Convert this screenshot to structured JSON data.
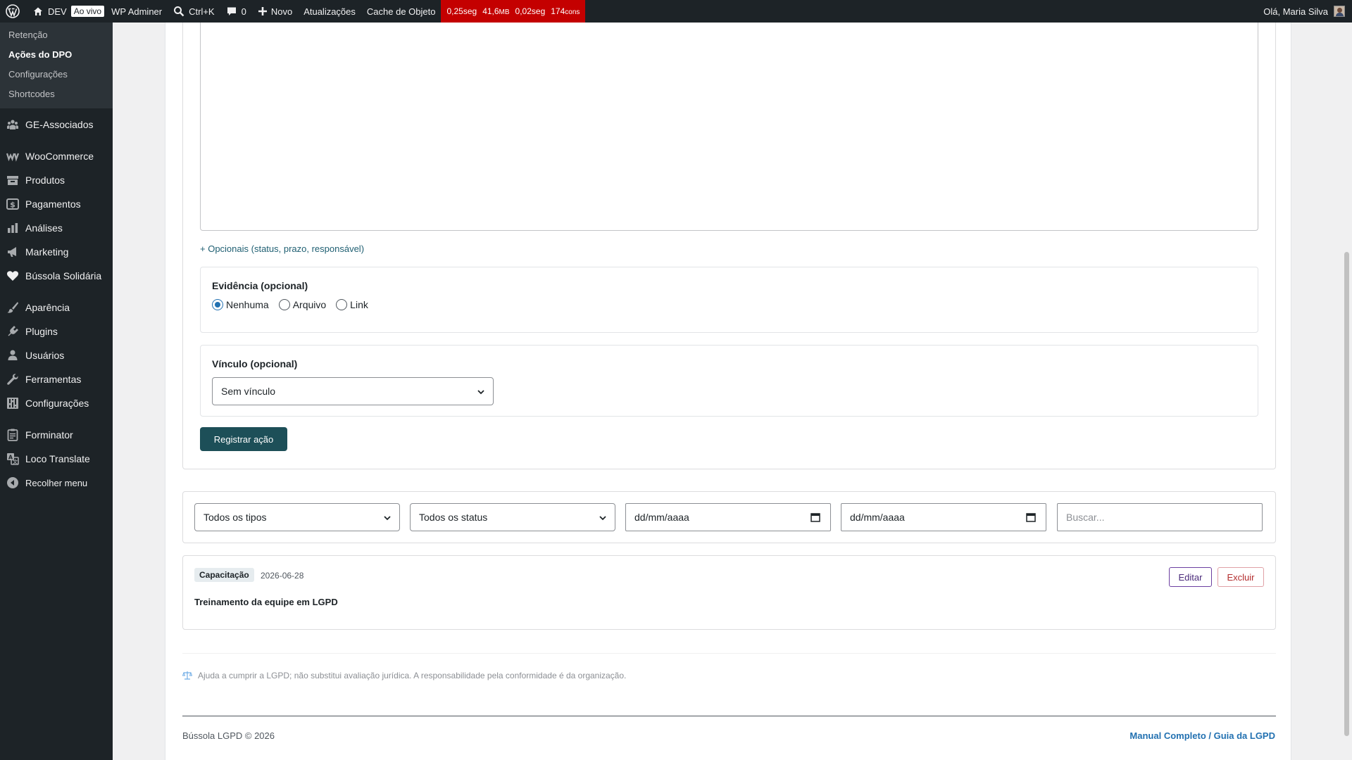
{
  "admin_bar": {
    "site_name": "DEV",
    "live_badge": "Ao vivo",
    "wp_adminer": "WP Adminer",
    "search_shortcut": "Ctrl+K",
    "comments_count": "0",
    "new_label": "Novo",
    "updates_label": "Atualizações",
    "object_cache_label": "Cache de Objeto",
    "perf": {
      "time": "0,25seg",
      "memory_value": "41,6",
      "memory_unit": "MB",
      "query_time": "0,02seg",
      "queries_value": "174",
      "queries_unit": "cons"
    },
    "greeting": "Olá, Maria Silva",
    "perf_color": "#c40000"
  },
  "sidebar": {
    "submenu": [
      {
        "label": "Retenção",
        "current": false
      },
      {
        "label": "Ações do DPO",
        "current": true
      },
      {
        "label": "Configurações",
        "current": false
      },
      {
        "label": "Shortcodes",
        "current": false
      }
    ],
    "items": [
      {
        "label": "GE-Associados",
        "icon": "groups-icon"
      },
      {
        "label": "WooCommerce",
        "icon": "woocommerce-icon"
      },
      {
        "label": "Produtos",
        "icon": "archive-icon"
      },
      {
        "label": "Pagamentos",
        "icon": "payments-icon"
      },
      {
        "label": "Análises",
        "icon": "chart-bar-icon"
      },
      {
        "label": "Marketing",
        "icon": "megaphone-icon"
      },
      {
        "label": "Bússola Solidária",
        "icon": "heart-icon"
      },
      {
        "label": "Aparência",
        "icon": "paintbrush-icon"
      },
      {
        "label": "Plugins",
        "icon": "plugin-icon"
      },
      {
        "label": "Usuários",
        "icon": "user-icon"
      },
      {
        "label": "Ferramentas",
        "icon": "wrench-icon"
      },
      {
        "label": "Configurações",
        "icon": "settings-icon"
      },
      {
        "label": "Forminator",
        "icon": "form-icon"
      },
      {
        "label": "Loco Translate",
        "icon": "translate-icon"
      },
      {
        "label": "Recolher menu",
        "icon": "collapse-icon"
      }
    ]
  },
  "form": {
    "optional_link": "+ Opcionais (status, prazo, responsável)",
    "evidence": {
      "label": "Evidência (opcional)",
      "options": [
        {
          "label": "Nenhuma",
          "checked": true
        },
        {
          "label": "Arquivo",
          "checked": false
        },
        {
          "label": "Link",
          "checked": false
        }
      ]
    },
    "link": {
      "label": "Vínculo (opcional)",
      "selected": "Sem vínculo"
    },
    "submit_label": "Registrar ação",
    "submit_color": "#1d4f58"
  },
  "filters": {
    "type_selected": "Todos os tipos",
    "status_selected": "Todos os status",
    "date_from_placeholder": "dd/mm/aaaa",
    "date_to_placeholder": "dd/mm/aaaa",
    "search_placeholder": "Buscar..."
  },
  "entries": [
    {
      "badge": "Capacitação",
      "date": "2026-06-28",
      "title": "Treinamento da equipe em LGPD",
      "edit_label": "Editar",
      "delete_label": "Excluir"
    }
  ],
  "disclaimer": "Ajuda a cumprir a LGPD; não substitui avaliação jurídica. A responsabilidade pela conformidade é da organização.",
  "footer": {
    "copyright": "Bússola LGPD © 2026",
    "manual_link": "Manual Completo / Guia da LGPD"
  }
}
